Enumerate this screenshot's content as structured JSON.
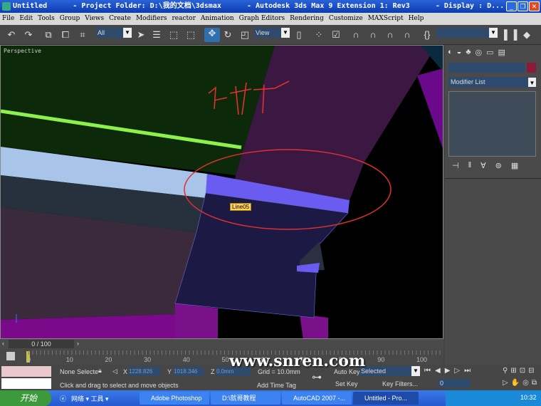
{
  "window": {
    "title": "Untitled      - Project Folder: D:\\我的文档\\3dsmax      - Autodesk 3ds Max 9 Extension 1: Rev3      - Display : D..."
  },
  "menu": [
    "File",
    "Edit",
    "Tools",
    "Group",
    "Views",
    "Create",
    "Modifiers",
    "reactor",
    "Animation",
    "Graph Editors",
    "Rendering",
    "Customize",
    "MAXScript",
    "Help"
  ],
  "toolbar": {
    "selection_filter": "All",
    "ref_coord": "View",
    "named_sel": ""
  },
  "viewport": {
    "label": "Perspective",
    "object_tooltip": "Line05",
    "annotation": "灯带"
  },
  "command_panel": {
    "modifier_list": "Modifier List",
    "object_name": ""
  },
  "time_slider": {
    "value": "0 / 100"
  },
  "trackbar": {
    "ticks": [
      "0",
      "10",
      "20",
      "30",
      "40",
      "50",
      "60",
      "70",
      "80",
      "90",
      "100"
    ]
  },
  "status": {
    "selection": "None Selecte",
    "x_label": "X",
    "x": "1228.826",
    "y_label": "Y",
    "y": "1018.346",
    "z_label": "Z",
    "z": "0.0mm",
    "grid": "Grid = 10.0mm",
    "prompt": "Click and drag to select and move objects",
    "add_time_tag": "Add Time Tag",
    "auto_key": "Auto Key",
    "key_mode": "Selected",
    "set_key": "Set Key",
    "key_filters": "Key Filters...",
    "frame": "0"
  },
  "taskbar": {
    "start": "开始",
    "quick": "网络 ▾ 工具 ▾",
    "tasks": [
      "Adobe Photoshop",
      "D:\\就哥教程",
      "AutoCAD 2007 -...",
      "Untitled   - Pro..."
    ],
    "clock": "10:32"
  },
  "watermark": "www.snren.com",
  "colors": {
    "accent": "#2a62d8",
    "selection_box": "#ffd060"
  }
}
